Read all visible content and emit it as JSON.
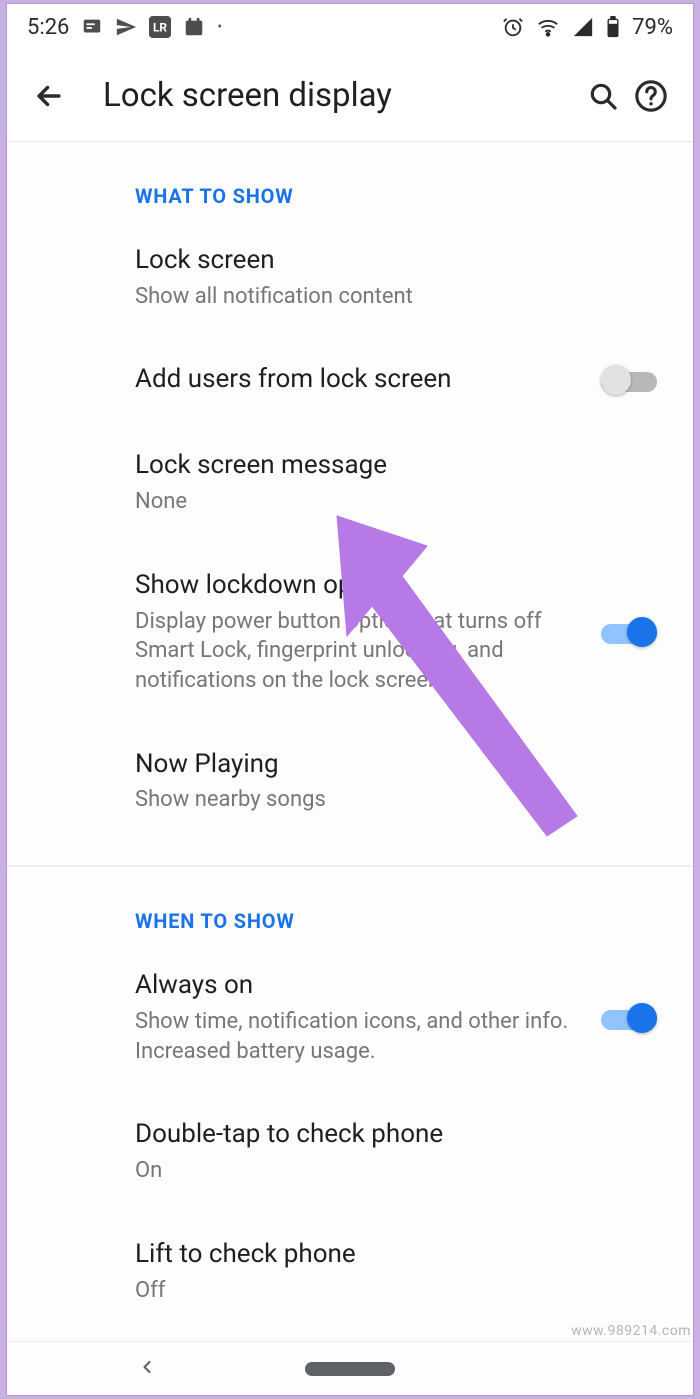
{
  "status_bar": {
    "time": "5:26",
    "battery_text": "79%"
  },
  "app_bar": {
    "title": "Lock screen display"
  },
  "sections": {
    "what_to_show": {
      "header": "WHAT TO SHOW",
      "lock_screen": {
        "title": "Lock screen",
        "sub": "Show all notification content"
      },
      "add_users": {
        "title": "Add users from lock screen",
        "enabled": false
      },
      "lock_screen_message": {
        "title": "Lock screen message",
        "sub": "None"
      },
      "show_lockdown": {
        "title": "Show lockdown option",
        "sub": "Display power button option that turns off Smart Lock, fingerprint unlocking, and notifications on the lock screen",
        "enabled": true
      },
      "now_playing": {
        "title": "Now Playing",
        "sub": "Show nearby songs"
      }
    },
    "when_to_show": {
      "header": "WHEN TO SHOW",
      "always_on": {
        "title": "Always on",
        "sub": "Show time, notification icons, and other info. Increased battery usage.",
        "enabled": true
      },
      "double_tap": {
        "title": "Double-tap to check phone",
        "sub": "On"
      },
      "lift": {
        "title": "Lift to check phone",
        "sub": "Off"
      }
    }
  },
  "watermark": "www.989214.com"
}
